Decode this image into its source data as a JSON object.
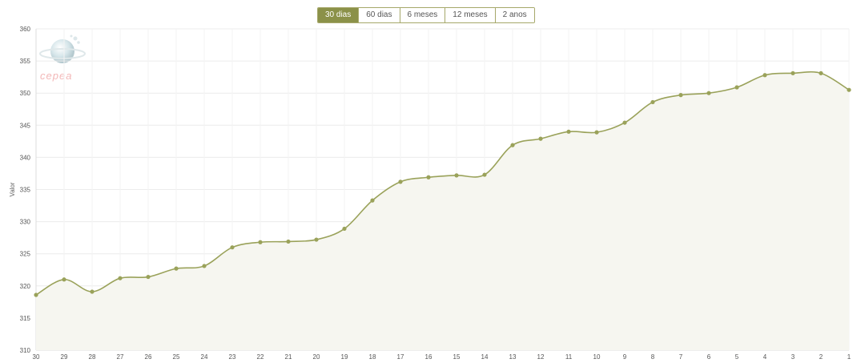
{
  "range_buttons": [
    {
      "label": "30 dias",
      "active": true
    },
    {
      "label": "60 dias",
      "active": false
    },
    {
      "label": "6 meses",
      "active": false
    },
    {
      "label": "12 meses",
      "active": false
    },
    {
      "label": "2 anos",
      "active": false
    }
  ],
  "logo": {
    "text": "cepea"
  },
  "colors": {
    "line": "#9aa25a",
    "fill": "#f6f6f0",
    "active_button": "#8b9149",
    "grid": "#ececec"
  },
  "chart_data": {
    "type": "area",
    "ylabel": "Valor",
    "xlabel": "",
    "ylim": [
      310,
      360
    ],
    "yticks": [
      310,
      315,
      320,
      325,
      330,
      335,
      340,
      345,
      350,
      355,
      360
    ],
    "grid": true,
    "categories": [
      "30",
      "29",
      "28",
      "27",
      "26",
      "25",
      "24",
      "23",
      "22",
      "21",
      "20",
      "19",
      "18",
      "17",
      "16",
      "15",
      "14",
      "13",
      "12",
      "11",
      "10",
      "9",
      "8",
      "7",
      "6",
      "5",
      "4",
      "3",
      "2",
      "1"
    ],
    "values": [
      318.6,
      321.0,
      319.1,
      321.2,
      321.4,
      322.7,
      323.1,
      326.0,
      326.8,
      326.9,
      327.2,
      328.9,
      333.3,
      336.2,
      336.9,
      337.2,
      337.3,
      341.9,
      342.9,
      344.0,
      343.9,
      345.4,
      348.6,
      349.7,
      350.0,
      350.9,
      352.8,
      353.1,
      353.1,
      350.5
    ]
  }
}
